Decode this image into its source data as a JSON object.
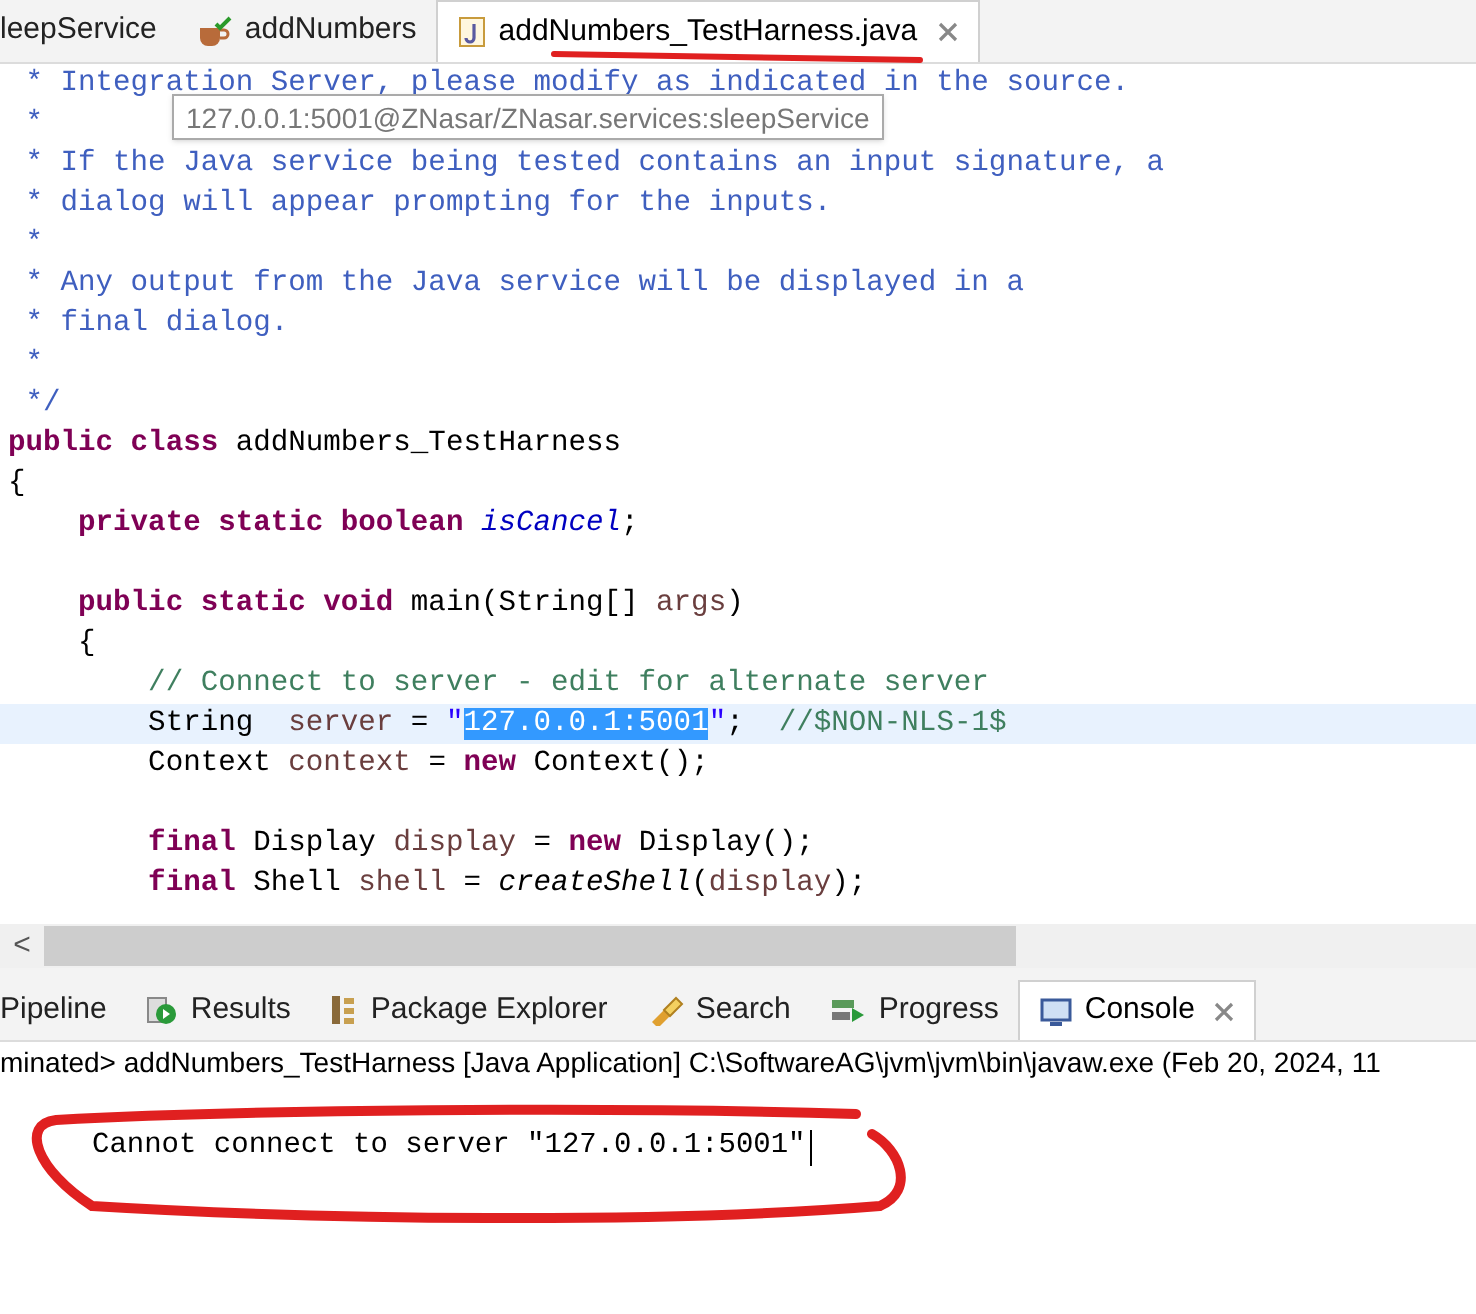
{
  "editor_tabs": [
    {
      "label": "leepService",
      "selected": false,
      "closable": false
    },
    {
      "label": "addNumbers",
      "selected": false,
      "closable": false
    },
    {
      "label": "addNumbers_TestHarness.java",
      "selected": true,
      "closable": true
    }
  ],
  "code_lines": [
    {
      "kind": "code",
      "highlighted": false,
      "segments": [
        {
          "kind": "javadoc",
          "text": " * Integration Server, please modify as indicated in the source."
        }
      ]
    },
    {
      "kind": "code",
      "highlighted": false,
      "segments": [
        {
          "kind": "javadoc",
          "text": " *"
        }
      ]
    },
    {
      "kind": "code",
      "highlighted": false,
      "segments": [
        {
          "kind": "javadoc",
          "text": " * If the Java service being tested contains an input signature, a"
        }
      ]
    },
    {
      "kind": "code",
      "highlighted": false,
      "segments": [
        {
          "kind": "javadoc",
          "text": " * dialog will appear prompting for the inputs."
        }
      ]
    },
    {
      "kind": "code",
      "highlighted": false,
      "segments": [
        {
          "kind": "javadoc",
          "text": " *"
        }
      ]
    },
    {
      "kind": "code",
      "highlighted": false,
      "segments": [
        {
          "kind": "javadoc",
          "text": " * Any output from the Java service will be displayed in a"
        }
      ]
    },
    {
      "kind": "code",
      "highlighted": false,
      "segments": [
        {
          "kind": "javadoc",
          "text": " * final dialog."
        }
      ]
    },
    {
      "kind": "code",
      "highlighted": false,
      "segments": [
        {
          "kind": "javadoc",
          "text": " *"
        }
      ]
    },
    {
      "kind": "code",
      "highlighted": false,
      "segments": [
        {
          "kind": "javadoc",
          "text": " */"
        }
      ]
    },
    {
      "kind": "code",
      "highlighted": false,
      "segments": [
        {
          "kind": "keyword",
          "text": "public class"
        },
        {
          "kind": "plain",
          "text": " addNumbers_TestHarness"
        }
      ]
    },
    {
      "kind": "code",
      "highlighted": false,
      "segments": [
        {
          "kind": "plain",
          "text": "{"
        }
      ]
    },
    {
      "kind": "code",
      "highlighted": false,
      "segments": [
        {
          "kind": "keyword",
          "text": "    private static boolean"
        },
        {
          "kind": "field",
          "text": " isCancel"
        },
        {
          "kind": "plain",
          "text": ";"
        }
      ]
    },
    {
      "kind": "blank"
    },
    {
      "kind": "code",
      "highlighted": false,
      "segments": [
        {
          "kind": "keyword",
          "text": "    public static void"
        },
        {
          "kind": "plain",
          "text": " main(String[] "
        },
        {
          "kind": "variable",
          "text": "args"
        },
        {
          "kind": "plain",
          "text": ")"
        }
      ]
    },
    {
      "kind": "code",
      "highlighted": false,
      "segments": [
        {
          "kind": "plain",
          "text": "    {"
        }
      ]
    },
    {
      "kind": "code",
      "highlighted": false,
      "segments": [
        {
          "kind": "comment",
          "text": "        // Connect to server - edit for alternate server"
        }
      ]
    },
    {
      "kind": "code",
      "highlighted": true,
      "segments": [
        {
          "kind": "plain",
          "text": "        String  "
        },
        {
          "kind": "variable",
          "text": "server"
        },
        {
          "kind": "plain",
          "text": " = "
        },
        {
          "kind": "string",
          "text": "\""
        },
        {
          "kind": "selection",
          "text": "127.0.0.1:5001"
        },
        {
          "kind": "string",
          "text": "\""
        },
        {
          "kind": "plain",
          "text": ";  "
        },
        {
          "kind": "comment",
          "text": "//$NON-NLS-1$"
        }
      ]
    },
    {
      "kind": "code",
      "highlighted": false,
      "segments": [
        {
          "kind": "plain",
          "text": "        Context "
        },
        {
          "kind": "variable",
          "text": "context"
        },
        {
          "kind": "plain",
          "text": " = "
        },
        {
          "kind": "keyword",
          "text": "new"
        },
        {
          "kind": "plain",
          "text": " Context();"
        }
      ]
    },
    {
      "kind": "blank"
    },
    {
      "kind": "code",
      "highlighted": false,
      "segments": [
        {
          "kind": "keyword",
          "text": "        final"
        },
        {
          "kind": "plain",
          "text": " Display "
        },
        {
          "kind": "variable",
          "text": "display"
        },
        {
          "kind": "plain",
          "text": " = "
        },
        {
          "kind": "keyword",
          "text": "new"
        },
        {
          "kind": "plain",
          "text": " Display();"
        }
      ]
    },
    {
      "kind": "code",
      "highlighted": false,
      "segments": [
        {
          "kind": "keyword",
          "text": "        final"
        },
        {
          "kind": "plain",
          "text": " Shell "
        },
        {
          "kind": "variable",
          "text": "shell"
        },
        {
          "kind": "plain",
          "text": " = "
        },
        {
          "kind": "method",
          "text": "createShell"
        },
        {
          "kind": "plain",
          "text": "("
        },
        {
          "kind": "variable",
          "text": "display"
        },
        {
          "kind": "plain",
          "text": ");"
        }
      ]
    }
  ],
  "tooltip": "127.0.0.1:5001@ZNasar/ZNasar.services:sleepService",
  "scroll_left": "<",
  "view_tabs": [
    {
      "label": "Pipeline",
      "selected": false,
      "closable": false
    },
    {
      "label": "Results",
      "selected": false,
      "closable": false
    },
    {
      "label": "Package Explorer",
      "selected": false,
      "closable": false
    },
    {
      "label": "Search",
      "selected": false,
      "closable": false
    },
    {
      "label": "Progress",
      "selected": false,
      "closable": false
    },
    {
      "label": "Console",
      "selected": true,
      "closable": true
    }
  ],
  "console": {
    "status": "minated> addNumbers_TestHarness [Java Application] C:\\SoftwareAG\\jvm\\jvm\\bin\\javaw.exe  (Feb 20, 2024, 11",
    "output": "Cannot connect to server \"127.0.0.1:5001\""
  }
}
